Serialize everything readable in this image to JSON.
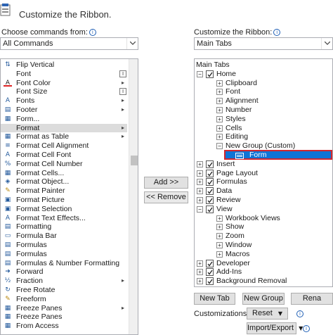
{
  "header": {
    "title": "Customize the Ribbon."
  },
  "left": {
    "choose_label": "Choose commands from:",
    "dropdown_value": "All Commands",
    "commands": [
      {
        "label": "Flip Vertical",
        "icon": "flip-vertical-icon",
        "glyph": "⇅"
      },
      {
        "label": "Font",
        "icon": "font-icon",
        "glyph": "",
        "side": "I"
      },
      {
        "label": "Font Color",
        "icon": "font-color-icon",
        "glyph": "A",
        "side": "▸"
      },
      {
        "label": "Font Size",
        "icon": "font-size-icon",
        "glyph": "",
        "side": "I"
      },
      {
        "label": "Fonts",
        "icon": "fonts-icon",
        "glyph": "A",
        "side": "▸"
      },
      {
        "label": "Footer",
        "icon": "footer-icon",
        "glyph": "▤",
        "side": "▸"
      },
      {
        "label": "Form...",
        "icon": "form-icon",
        "glyph": "▦"
      },
      {
        "label": "Format",
        "icon": "format-icon",
        "glyph": "",
        "side": "▸"
      },
      {
        "label": "Format as Table",
        "icon": "format-as-table-icon",
        "glyph": "▦",
        "side": "▸"
      },
      {
        "label": "Format Cell Alignment",
        "icon": "format-cell-alignment-icon",
        "glyph": "≡"
      },
      {
        "label": "Format Cell Font",
        "icon": "format-cell-font-icon",
        "glyph": "A"
      },
      {
        "label": "Format Cell Number",
        "icon": "format-cell-number-icon",
        "glyph": "%"
      },
      {
        "label": "Format Cells...",
        "icon": "format-cells-icon",
        "glyph": "▦"
      },
      {
        "label": "Format Object...",
        "icon": "format-object-icon",
        "glyph": "◈"
      },
      {
        "label": "Format Painter",
        "icon": "format-painter-icon",
        "glyph": "✎"
      },
      {
        "label": "Format Picture",
        "icon": "format-picture-icon",
        "glyph": "▣"
      },
      {
        "label": "Format Selection",
        "icon": "format-selection-icon",
        "glyph": "▣"
      },
      {
        "label": "Format Text Effects...",
        "icon": "format-text-effects-icon",
        "glyph": "A"
      },
      {
        "label": "Formatting",
        "icon": "formatting-icon",
        "glyph": "▤"
      },
      {
        "label": "Formula Bar",
        "icon": "formula-bar-icon",
        "glyph": "▭"
      },
      {
        "label": "Formulas",
        "icon": "formulas-icon",
        "glyph": "▤"
      },
      {
        "label": "Formulas",
        "icon": "formulas-2-icon",
        "glyph": "▤"
      },
      {
        "label": "Formulas & Number Formatting",
        "icon": "formulas-number-formatting-icon",
        "glyph": "▤"
      },
      {
        "label": "Forward",
        "icon": "forward-icon",
        "glyph": "➜"
      },
      {
        "label": "Fraction",
        "icon": "fraction-icon",
        "glyph": "½",
        "side": "▸"
      },
      {
        "label": "Free Rotate",
        "icon": "free-rotate-icon",
        "glyph": "↻"
      },
      {
        "label": "Freeform",
        "icon": "freeform-icon",
        "glyph": "✎"
      },
      {
        "label": "Freeze Panes",
        "icon": "freeze-panes-icon",
        "glyph": "▦",
        "side": "▸"
      },
      {
        "label": "Freeze Panes",
        "icon": "freeze-panes-2-icon",
        "glyph": "▦"
      },
      {
        "label": "From Access",
        "icon": "from-access-icon",
        "glyph": "▦"
      }
    ]
  },
  "middle": {
    "add_label": "Add >>",
    "remove_label": "<< Remove"
  },
  "right": {
    "customize_label": "Customize the Ribbon:",
    "dropdown_value": "Main Tabs",
    "tree": {
      "header": "Main Tabs",
      "home": "Home",
      "home_children": [
        "Clipboard",
        "Font",
        "Alignment",
        "Number",
        "Styles",
        "Cells",
        "Editing",
        "New Group (Custom)"
      ],
      "form": "Form",
      "tabs_a": [
        "Insert",
        "Page Layout",
        "Formulas",
        "Data",
        "Review",
        "View"
      ],
      "view_children": [
        "Workbook Views",
        "Show",
        "Zoom",
        "Window",
        "Macros"
      ],
      "tabs_b": [
        "Developer",
        "Add-Ins",
        "Background Removal"
      ]
    },
    "new_tab": "New Tab",
    "new_group": "New Group",
    "rename": "Rena",
    "customizations_label": "Customizations:",
    "reset": "Reset",
    "import_export": "Import/Export"
  }
}
